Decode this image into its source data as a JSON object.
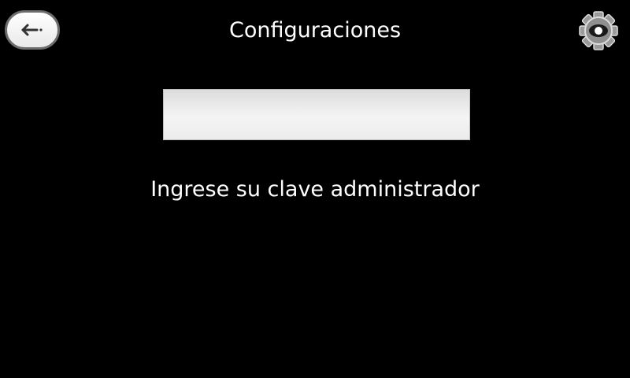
{
  "header": {
    "title": "Configuraciones",
    "back_icon": "back-arrow-icon",
    "settings_icon": "gear-icon"
  },
  "main": {
    "password_value": "",
    "instruction": "Ingrese su clave administrador"
  },
  "colors": {
    "background": "#000000",
    "text": "#ffffff",
    "field": "#eeeeee"
  }
}
